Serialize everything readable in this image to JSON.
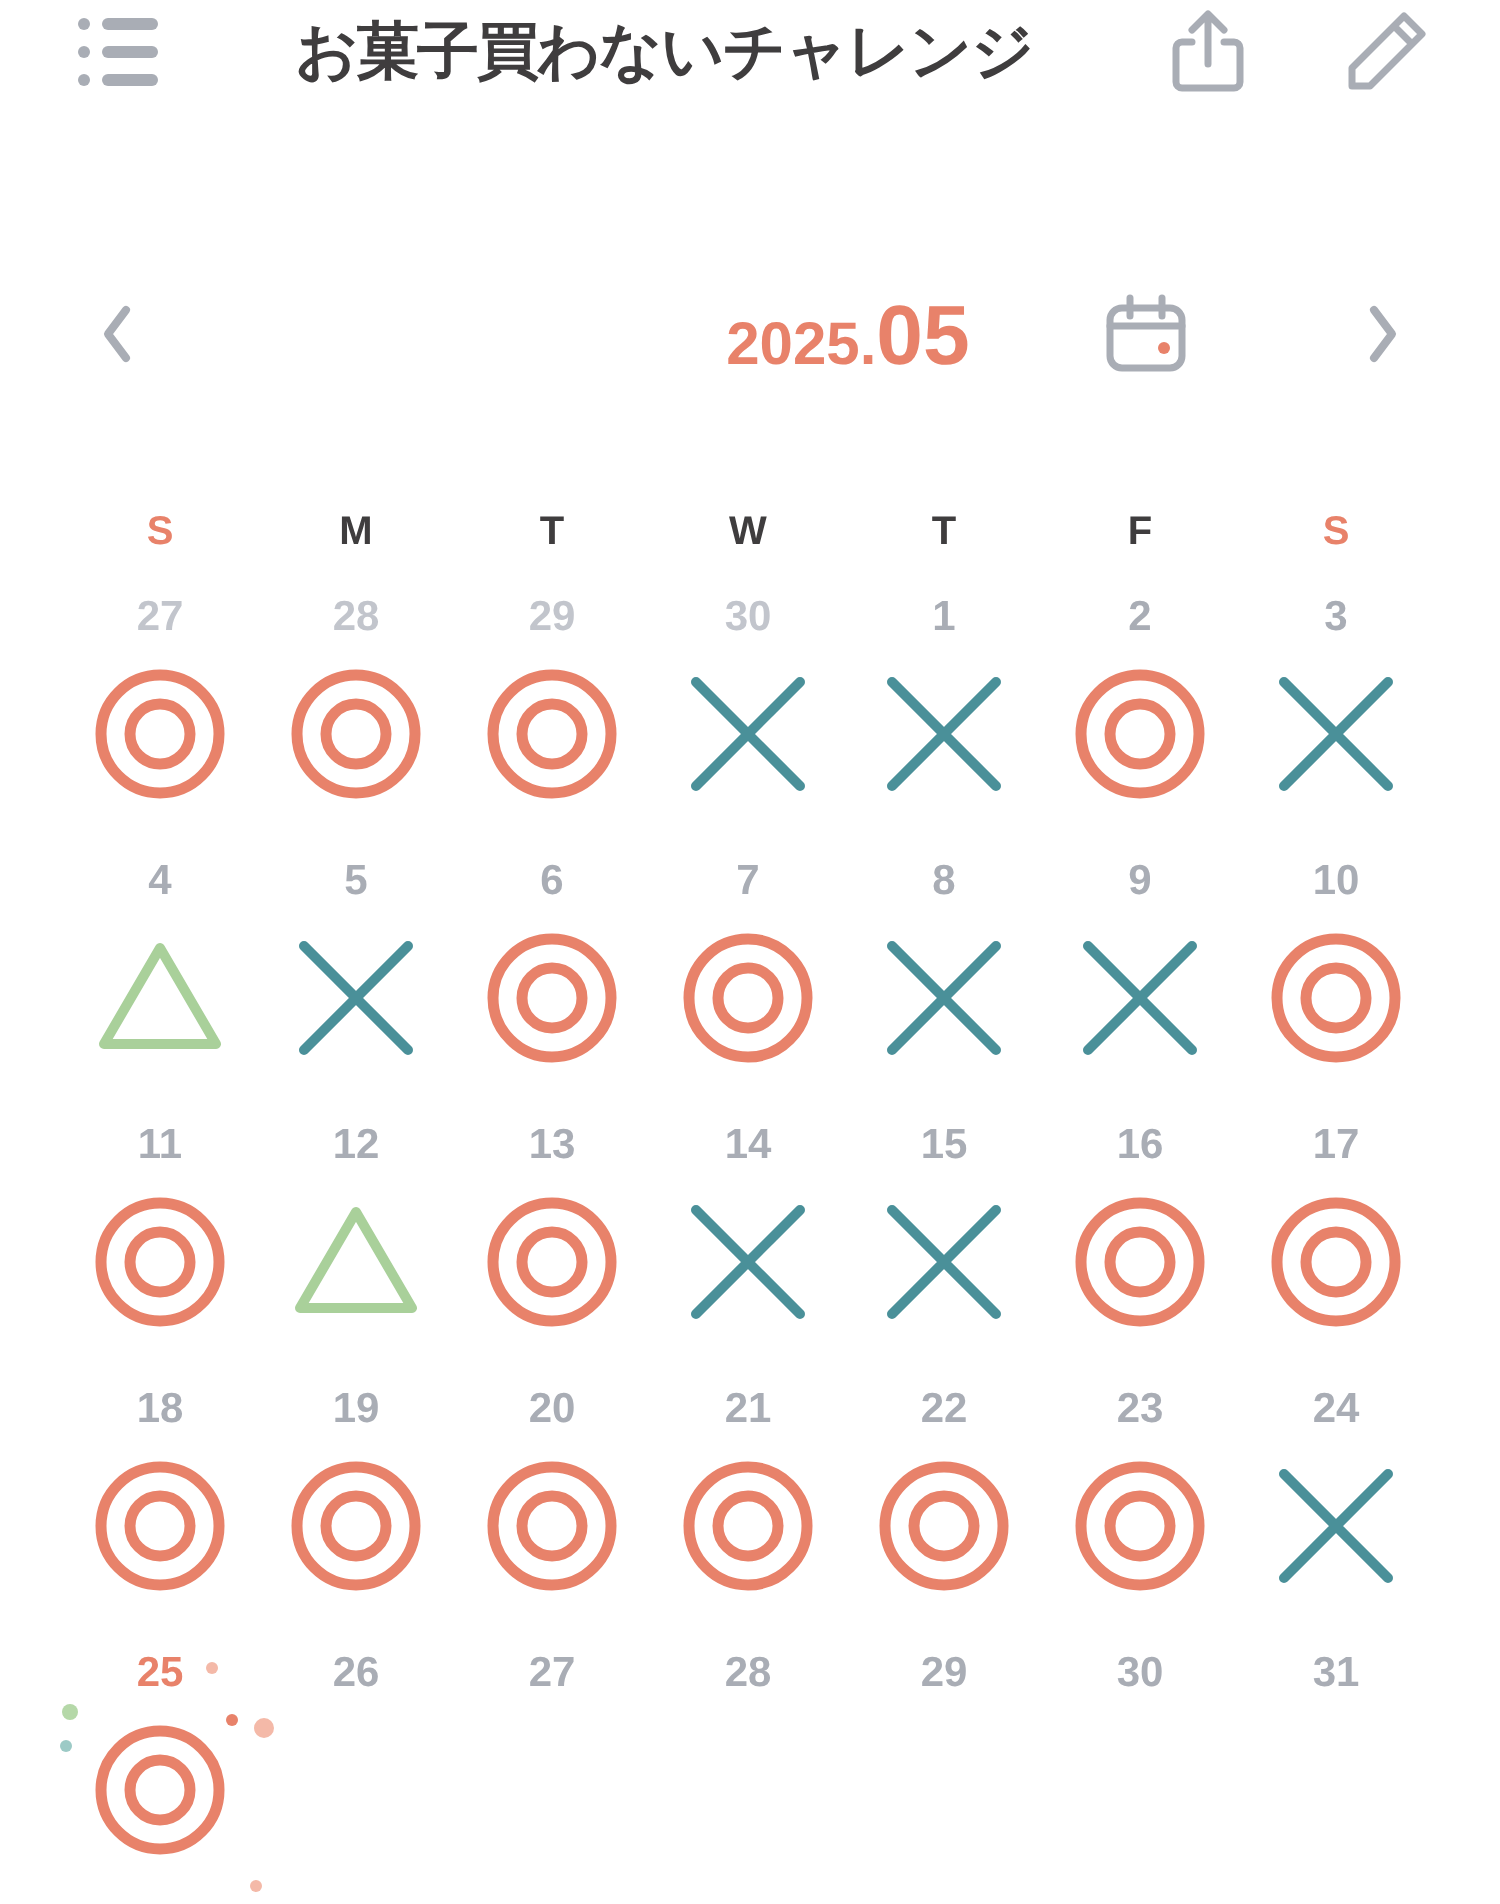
{
  "header": {
    "title": "お菓子買わないチャレンジ"
  },
  "month_nav": {
    "year": "2025.",
    "month": "05"
  },
  "weekdays": [
    {
      "label": "S",
      "color": "#e8826a"
    },
    {
      "label": "M",
      "color": "#3f3d3e"
    },
    {
      "label": "T",
      "color": "#3f3d3e"
    },
    {
      "label": "W",
      "color": "#3f3d3e"
    },
    {
      "label": "T",
      "color": "#3f3d3e"
    },
    {
      "label": "F",
      "color": "#3f3d3e"
    },
    {
      "label": "S",
      "color": "#e8826a"
    }
  ],
  "days": [
    {
      "day": "27",
      "other_month": true,
      "today": false,
      "kind": "circle"
    },
    {
      "day": "28",
      "other_month": true,
      "today": false,
      "kind": "circle"
    },
    {
      "day": "29",
      "other_month": true,
      "today": false,
      "kind": "circle"
    },
    {
      "day": "30",
      "other_month": true,
      "today": false,
      "kind": "cross"
    },
    {
      "day": "1",
      "other_month": false,
      "today": false,
      "kind": "cross"
    },
    {
      "day": "2",
      "other_month": false,
      "today": false,
      "kind": "circle"
    },
    {
      "day": "3",
      "other_month": false,
      "today": false,
      "kind": "cross"
    },
    {
      "day": "4",
      "other_month": false,
      "today": false,
      "kind": "triangle"
    },
    {
      "day": "5",
      "other_month": false,
      "today": false,
      "kind": "cross"
    },
    {
      "day": "6",
      "other_month": false,
      "today": false,
      "kind": "circle"
    },
    {
      "day": "7",
      "other_month": false,
      "today": false,
      "kind": "circle"
    },
    {
      "day": "8",
      "other_month": false,
      "today": false,
      "kind": "cross"
    },
    {
      "day": "9",
      "other_month": false,
      "today": false,
      "kind": "cross"
    },
    {
      "day": "10",
      "other_month": false,
      "today": false,
      "kind": "circle"
    },
    {
      "day": "11",
      "other_month": false,
      "today": false,
      "kind": "circle"
    },
    {
      "day": "12",
      "other_month": false,
      "today": false,
      "kind": "triangle"
    },
    {
      "day": "13",
      "other_month": false,
      "today": false,
      "kind": "circle"
    },
    {
      "day": "14",
      "other_month": false,
      "today": false,
      "kind": "cross"
    },
    {
      "day": "15",
      "other_month": false,
      "today": false,
      "kind": "cross"
    },
    {
      "day": "16",
      "other_month": false,
      "today": false,
      "kind": "circle"
    },
    {
      "day": "17",
      "other_month": false,
      "today": false,
      "kind": "circle"
    },
    {
      "day": "18",
      "other_month": false,
      "today": false,
      "kind": "circle"
    },
    {
      "day": "19",
      "other_month": false,
      "today": false,
      "kind": "circle"
    },
    {
      "day": "20",
      "other_month": false,
      "today": false,
      "kind": "circle"
    },
    {
      "day": "21",
      "other_month": false,
      "today": false,
      "kind": "circle"
    },
    {
      "day": "22",
      "other_month": false,
      "today": false,
      "kind": "circle"
    },
    {
      "day": "23",
      "other_month": false,
      "today": false,
      "kind": "circle"
    },
    {
      "day": "24",
      "other_month": false,
      "today": false,
      "kind": "cross"
    },
    {
      "day": "25",
      "other_month": false,
      "today": true,
      "kind": "circle"
    },
    {
      "day": "26",
      "other_month": false,
      "today": false,
      "kind": "blank"
    },
    {
      "day": "27",
      "other_month": false,
      "today": false,
      "kind": "blank"
    },
    {
      "day": "28",
      "other_month": false,
      "today": false,
      "kind": "blank"
    },
    {
      "day": "29",
      "other_month": false,
      "today": false,
      "kind": "blank"
    },
    {
      "day": "30",
      "other_month": false,
      "today": false,
      "kind": "blank"
    },
    {
      "day": "31",
      "other_month": false,
      "today": false,
      "kind": "blank"
    }
  ]
}
